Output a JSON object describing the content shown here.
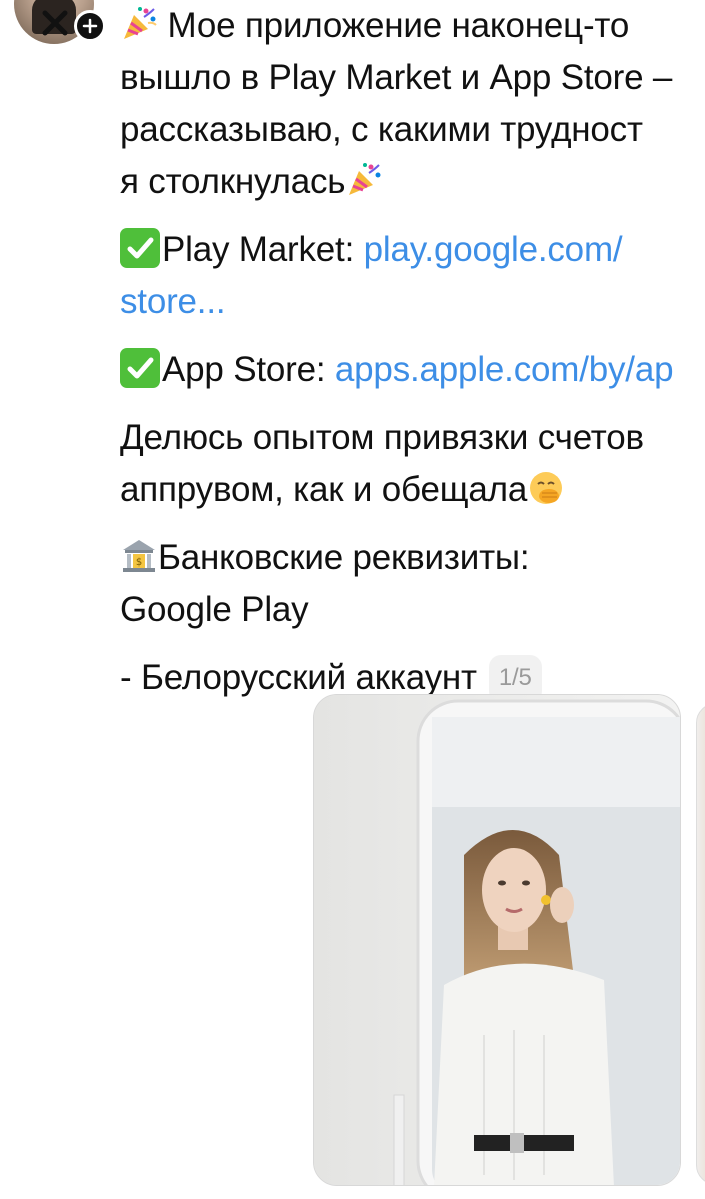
{
  "post": {
    "line1": "Мое приложение наконец-то",
    "line2": "вышло в Play Market и App Store –",
    "line3": "рассказываю, с какими трудност",
    "line4": "я столкнулась",
    "play_label": "Play Market: ",
    "play_link_1": "play.google.com/",
    "play_link_2": "store...",
    "app_label": "App Store: ",
    "app_link": "apps.apple.com/by/ap",
    "share_1": "Делюсь опытом привязки счетов",
    "share_2": "аппрувом, как и обещала",
    "bank_label": "Банковские реквизиты:",
    "google_play": "Google Play",
    "belarus": "- Белорусский аккаунт",
    "counter": "1/5"
  },
  "icons": {
    "avatar": "profile-avatar",
    "add": "plus-icon",
    "party": "party-popper-icon",
    "check": "check-mark-button-icon",
    "face": "face-with-hand-over-mouth-icon",
    "bank": "bank-icon"
  },
  "colors": {
    "link": "#3d8ee6",
    "check": "#4fbf3a",
    "text": "#111111",
    "counter_bg": "#f1f1f1",
    "counter_text": "#9a9a9a"
  }
}
